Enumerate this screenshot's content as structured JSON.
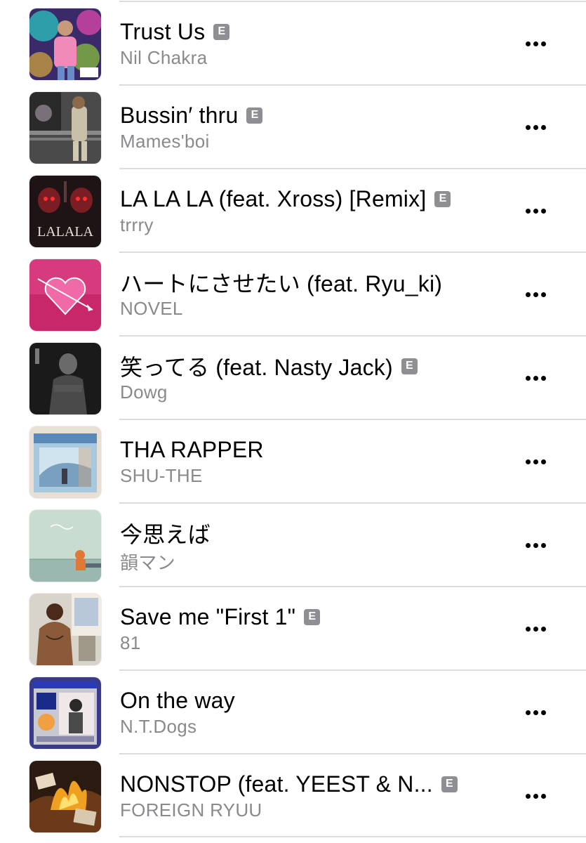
{
  "explicit_badge": "E",
  "tracks": [
    {
      "title": "Trust Us",
      "artist": "Nil Chakra",
      "explicit": true,
      "artwork": "artwork-trust-us"
    },
    {
      "title": "Bussin′ thru",
      "artist": "Mames'boi",
      "explicit": true,
      "artwork": "artwork-bussin-thru"
    },
    {
      "title": "LA LA LA (feat. Xross) [Remix]",
      "artist": "trrry",
      "explicit": true,
      "artwork": "artwork-la-la-la",
      "artwork_text": "LALALA"
    },
    {
      "title": "ハートにさせたい (feat. Ryu_ki)",
      "artist": "NOVEL",
      "explicit": false,
      "artwork": "artwork-heart"
    },
    {
      "title": "笑ってる (feat. Nasty Jack)",
      "artist": "Dowg",
      "explicit": true,
      "artwork": "artwork-waratteru"
    },
    {
      "title": "THA RAPPER",
      "artist": "SHU-THE",
      "explicit": false,
      "artwork": "artwork-tha-rapper"
    },
    {
      "title": "今思えば",
      "artist": "韻マン",
      "explicit": false,
      "artwork": "artwork-ima-omoeba"
    },
    {
      "title": "Save me \"First 1\"",
      "artist": "81",
      "explicit": true,
      "artwork": "artwork-save-me"
    },
    {
      "title": "On the way",
      "artist": "N.T.Dogs",
      "explicit": false,
      "artwork": "artwork-on-the-way"
    },
    {
      "title": "NONSTOP (feat. YEEST & N...",
      "artist": "FOREIGN RYUU",
      "explicit": true,
      "artwork": "artwork-nonstop"
    }
  ],
  "more_icon": "ellipsis-icon"
}
